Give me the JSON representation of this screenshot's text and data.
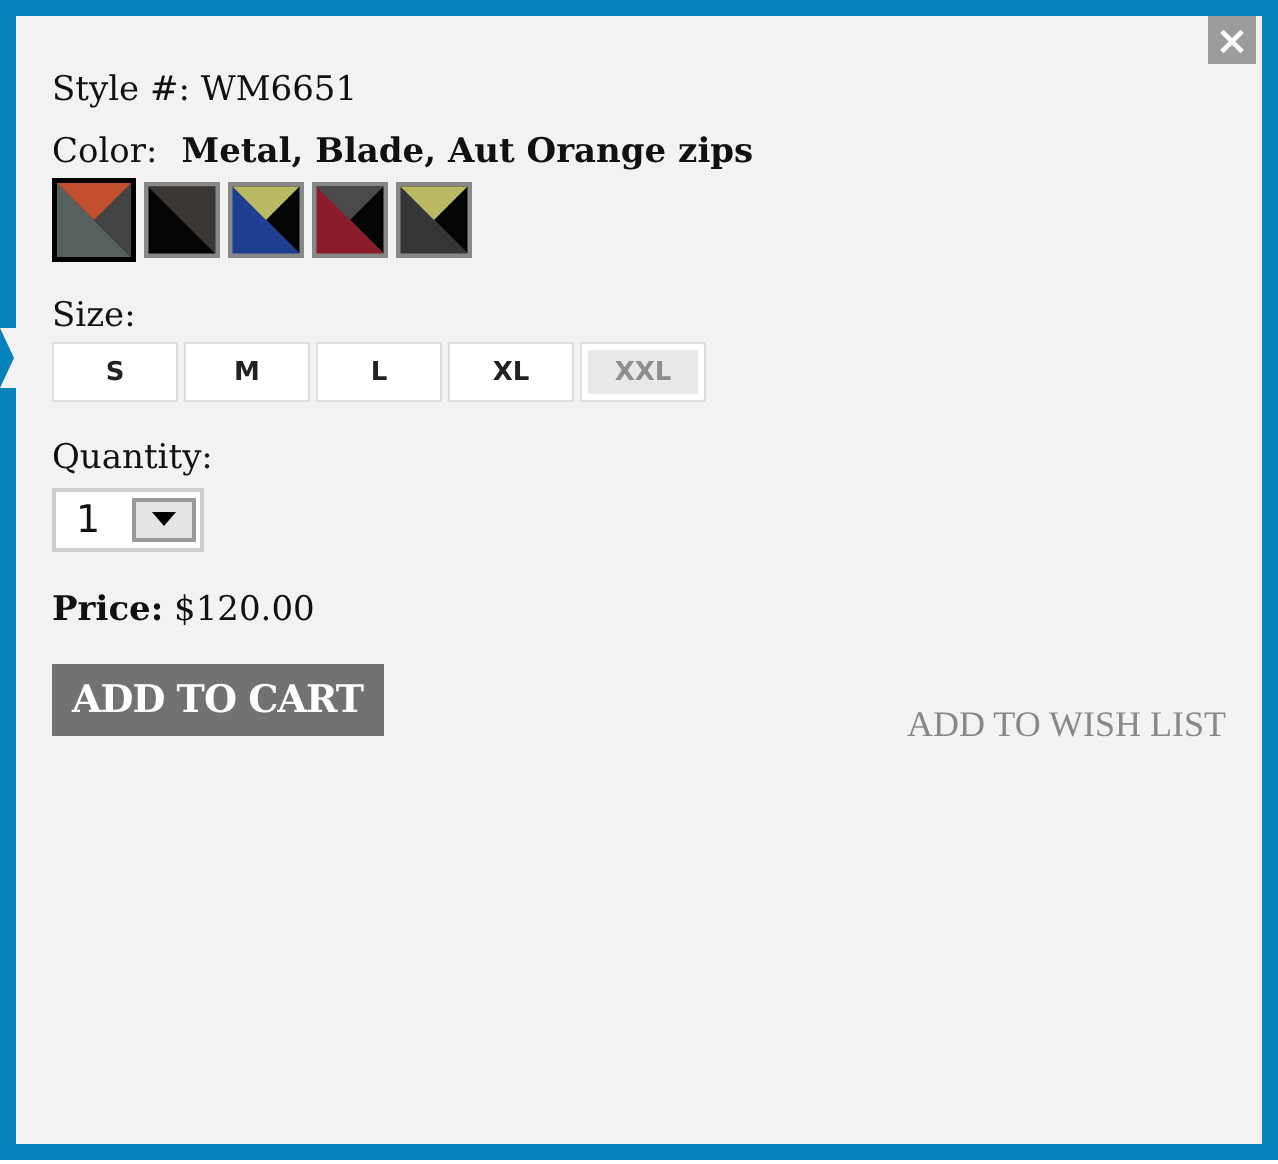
{
  "close_button": "×",
  "style": {
    "label": "Style #:",
    "value": "WM6651"
  },
  "color": {
    "label": "Color:",
    "value": "Metal, Blade, Aut Orange zips"
  },
  "swatches": [
    {
      "selected": true,
      "parts": [
        {
          "color": "#444444"
        },
        {
          "color": "#55605f"
        },
        {
          "color": "#c24f2d"
        }
      ]
    },
    {
      "selected": false,
      "parts": [
        {
          "color": "#3b3735"
        },
        {
          "color": "#050505"
        },
        {
          "color": "#3b3735"
        }
      ]
    },
    {
      "selected": false,
      "parts": [
        {
          "color": "#050505"
        },
        {
          "color": "#1e3f91"
        },
        {
          "color": "#b9b964"
        }
      ]
    },
    {
      "selected": false,
      "parts": [
        {
          "color": "#050505"
        },
        {
          "color": "#8c1b2c"
        },
        {
          "color": "#4a4a4a"
        }
      ]
    },
    {
      "selected": false,
      "parts": [
        {
          "color": "#050505"
        },
        {
          "color": "#353535"
        },
        {
          "color": "#b9b964"
        }
      ]
    }
  ],
  "size": {
    "label": "Size:",
    "options": [
      {
        "label": "S",
        "disabled": false
      },
      {
        "label": "M",
        "disabled": false
      },
      {
        "label": "L",
        "disabled": false
      },
      {
        "label": "XL",
        "disabled": false
      },
      {
        "label": "XXL",
        "disabled": true
      }
    ]
  },
  "quantity": {
    "label": "Quantity:",
    "value": "1"
  },
  "price": {
    "label": "Price:",
    "value": "$120.00"
  },
  "add_to_cart": "ADD TO CART",
  "wish_list": "ADD TO WISH LIST"
}
